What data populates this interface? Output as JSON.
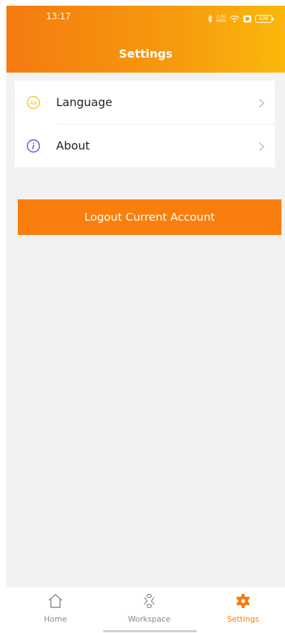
{
  "status_bar": {
    "time": "13:17",
    "net_speed_value": "2.00",
    "net_speed_unit": "KB/S",
    "battery": "100",
    "icons": [
      "bluetooth-icon",
      "wifi-icon",
      "sim-icon",
      "battery-icon"
    ]
  },
  "header": {
    "title": "Settings"
  },
  "menu": {
    "items": [
      {
        "label": "Language",
        "icon": "language-icon"
      },
      {
        "label": "About",
        "icon": "info-icon"
      }
    ]
  },
  "logout_label": "Logout Current Account",
  "tabbar": {
    "tabs": [
      {
        "label": "Home",
        "icon": "home-icon",
        "active": false
      },
      {
        "label": "Workspace",
        "icon": "workspace-icon",
        "active": false
      },
      {
        "label": "Settings",
        "icon": "gear-icon",
        "active": true
      }
    ]
  },
  "colors": {
    "accent": "#f47b10",
    "header_end": "#fbb80c",
    "button": "#fa7e0d",
    "language_icon": "#f3c73a",
    "info_icon": "#5e55c6",
    "inactive_tab": "#8a8a8a"
  }
}
